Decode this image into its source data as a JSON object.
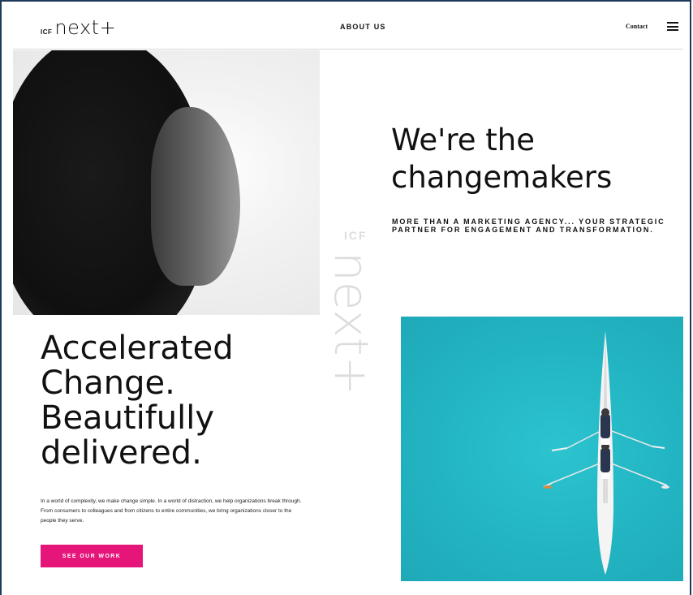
{
  "header": {
    "logo_prefix": "ICF",
    "logo_name": "next",
    "logo_plus": "+",
    "nav_about": "ABOUT US",
    "nav_contact": "Contact",
    "menu_icon": "hamburger-menu-icon"
  },
  "hero": {
    "headline_line1": "We're the",
    "headline_line2": "changemakers",
    "subline": "MORE THAN A MARKETING AGENCY... YOUR STRATEGIC PARTNER FOR ENGAGEMENT AND TRANSFORMATION."
  },
  "brand_watermark": {
    "prefix": "ICF",
    "name": "next+"
  },
  "intro": {
    "heading_line1": "Accelerated",
    "heading_line2": "Change.",
    "heading_line3": "Beautifully",
    "heading_line4": "delivered.",
    "body": "In a world of complexity, we make change simple. In a world of distraction, we help organizations break through. From consumers to colleagues and from citizens to entire communities, we bring organizations closer to the people they serve.",
    "cta_label": "SEE OUR WORK"
  },
  "colors": {
    "accent": "#e5157a",
    "water": "#22b4c2",
    "text": "#111111"
  }
}
